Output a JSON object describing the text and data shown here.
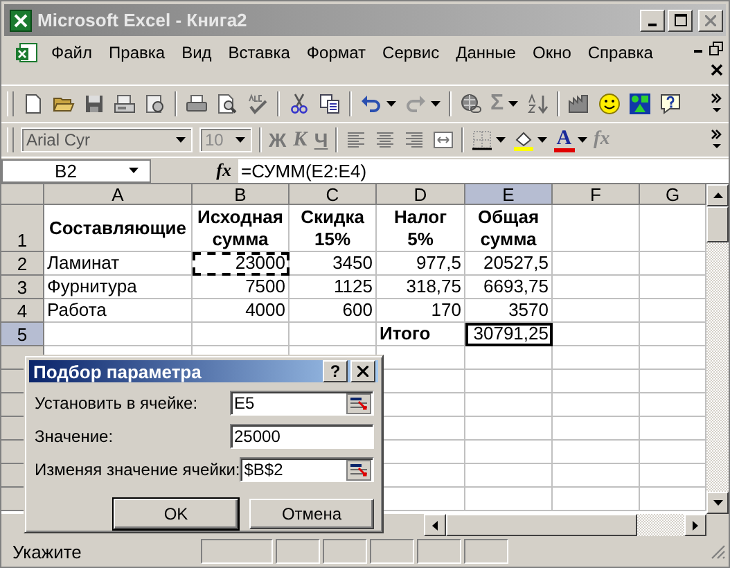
{
  "window": {
    "title": "Microsoft Excel - Книга2"
  },
  "menu": [
    "Файл",
    "Правка",
    "Вид",
    "Вставка",
    "Формат",
    "Сервис",
    "Данные",
    "Окно",
    "Справка"
  ],
  "standard_toolbar": {
    "sum_glyph": "Σ"
  },
  "formatting_toolbar": {
    "font": "Arial Cyr",
    "size": "10",
    "size_disabled": true,
    "bold_glyph": "Ж",
    "italic_glyph": "К",
    "underline_glyph": "Ч",
    "font_color_glyph": "A",
    "function_glyph": "fx"
  },
  "formula_bar": {
    "name_box": "B2",
    "fx": "fx",
    "formula": "=СУММ(E2:E4)"
  },
  "columns": [
    {
      "label": "A",
      "selected": false
    },
    {
      "label": "B",
      "selected": false
    },
    {
      "label": "C",
      "selected": false
    },
    {
      "label": "D",
      "selected": false
    },
    {
      "label": "E",
      "selected": true
    },
    {
      "label": "F",
      "selected": false
    },
    {
      "label": "G",
      "selected": false
    }
  ],
  "rows": [
    {
      "label": "1",
      "selected": false,
      "cells": [
        {
          "text": "Составляющие",
          "kind": "heading"
        },
        {
          "text": "Исходная сумма",
          "kind": "heading"
        },
        {
          "text": "Скидка 15%",
          "kind": "heading"
        },
        {
          "text": "Налог 5%",
          "kind": "heading"
        },
        {
          "text": "Общая сумма",
          "kind": "heading"
        },
        null,
        null
      ]
    },
    {
      "label": "2",
      "selected": false,
      "cells": [
        {
          "text": "Ламинат",
          "kind": "text"
        },
        {
          "text": "23000",
          "kind": "number",
          "copied": true
        },
        {
          "text": "3450",
          "kind": "number"
        },
        {
          "text": "977,5",
          "kind": "number"
        },
        {
          "text": "20527,5",
          "kind": "number"
        },
        null,
        null
      ]
    },
    {
      "label": "3",
      "selected": false,
      "cells": [
        {
          "text": "Фурнитура",
          "kind": "text"
        },
        {
          "text": "7500",
          "kind": "number"
        },
        {
          "text": "1125",
          "kind": "number"
        },
        {
          "text": "318,75",
          "kind": "number"
        },
        {
          "text": "6693,75",
          "kind": "number"
        },
        null,
        null
      ]
    },
    {
      "label": "4",
      "selected": false,
      "cells": [
        {
          "text": "Работа",
          "kind": "text"
        },
        {
          "text": "4000",
          "kind": "number"
        },
        {
          "text": "600",
          "kind": "number"
        },
        {
          "text": "170",
          "kind": "number"
        },
        {
          "text": "3570",
          "kind": "number"
        },
        null,
        null
      ]
    },
    {
      "label": "5",
      "selected": true,
      "cells": [
        null,
        null,
        null,
        {
          "text": "Итого",
          "kind": "label"
        },
        {
          "text": "30791,25",
          "kind": "number",
          "selected": true
        },
        null,
        null
      ]
    }
  ],
  "dialog": {
    "title": "Подбор параметра",
    "help": "?",
    "fields": [
      {
        "label": "Установить в ячейке:",
        "value": "E5",
        "kind": "reference"
      },
      {
        "label": "Значение:",
        "value": "25000",
        "kind": "plain"
      },
      {
        "label": "Изменяя значение ячейки:",
        "value": "$B$2",
        "kind": "reference"
      }
    ],
    "buttons": [
      {
        "label": "OK",
        "default": true
      },
      {
        "label": "Отмена",
        "default": false
      }
    ]
  },
  "status_bar": {
    "text": "Укажите"
  }
}
